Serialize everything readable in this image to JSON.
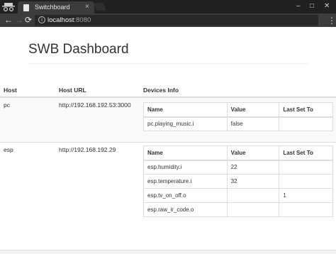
{
  "browser": {
    "tab_title": "Switchboard",
    "tab_close": "×",
    "url_host": "localhost",
    "url_port": ":8080",
    "window_controls": [
      "–",
      "□",
      "✕"
    ],
    "nav": {
      "back": "←",
      "forward": "→",
      "reload": "⟳"
    },
    "menu": "⋮"
  },
  "page": {
    "title": "SWB Dashboard"
  },
  "table": {
    "headers": {
      "host": "Host",
      "url": "Host URL",
      "devices": "Devices Info"
    },
    "device_headers": {
      "name": "Name",
      "value": "Value",
      "last_set": "Last Set To"
    },
    "hosts": [
      {
        "host": "pc",
        "url": "http://192.168.192.53:3000",
        "devices": [
          {
            "name": "pc.playing_music.i",
            "value": "false",
            "last_set": ""
          }
        ]
      },
      {
        "host": "esp",
        "url": "http://192.168.192.29",
        "devices": [
          {
            "name": "esp.humidity.i",
            "value": "22",
            "last_set": ""
          },
          {
            "name": "esp.temperature.i",
            "value": "32",
            "last_set": ""
          },
          {
            "name": "esp.tv_on_off.o",
            "value": "",
            "last_set": "1"
          },
          {
            "name": "esp.raw_ir_code.o",
            "value": "",
            "last_set": ""
          }
        ]
      }
    ]
  }
}
